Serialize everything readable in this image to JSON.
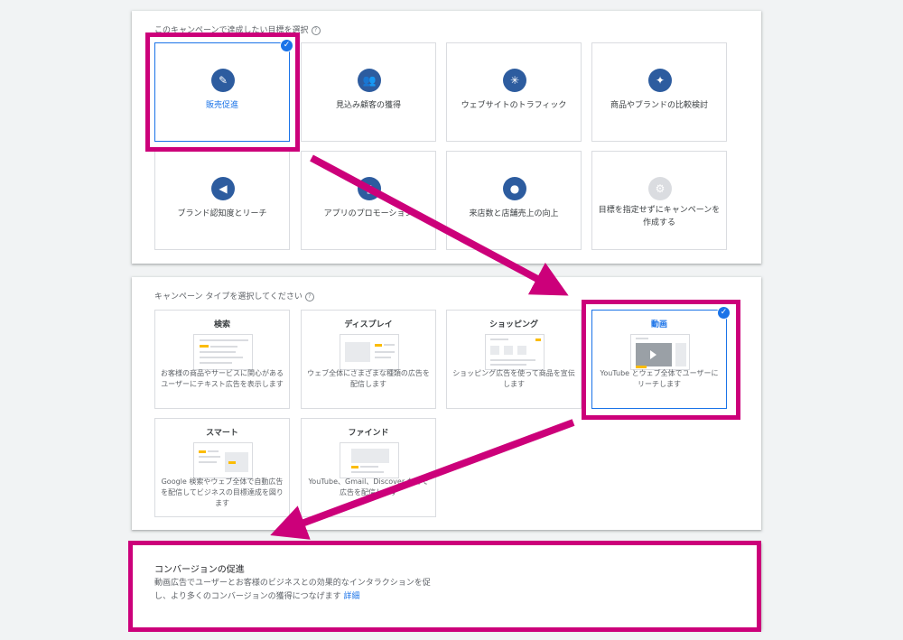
{
  "goal_section": {
    "label": "このキャンペーンで達成したい目標を選択",
    "help_icon": "?",
    "goals": [
      {
        "label": "販売促進",
        "icon": "tag-icon",
        "glyph": "✎",
        "selected": true
      },
      {
        "label": "見込み顧客の獲得",
        "icon": "people-icon",
        "glyph": "👥",
        "selected": false
      },
      {
        "label": "ウェブサイトのトラフィック",
        "icon": "cursor-click-icon",
        "glyph": "✳",
        "selected": false
      },
      {
        "label": "商品やブランドの比較検討",
        "icon": "sparkle-icon",
        "glyph": "✦",
        "selected": false
      },
      {
        "label": "ブランド認知度とリーチ",
        "icon": "speaker-icon",
        "glyph": "◀",
        "selected": false
      },
      {
        "label": "アプリのプロモーション",
        "icon": "phone-icon",
        "glyph": "▯",
        "selected": false
      },
      {
        "label": "来店数と店舗売上の向上",
        "icon": "location-pin-icon",
        "glyph": "●",
        "selected": false
      },
      {
        "label": "目標を指定せずにキャンペーンを作成する",
        "icon": "gear-icon",
        "glyph": "⚙",
        "selected": false
      }
    ]
  },
  "type_section": {
    "label": "キャンペーン タイプを選択してください",
    "help_icon": "?",
    "types": [
      {
        "title": "検索",
        "desc": "お客様の商品やサービスに関心があるユーザーにテキスト広告を表示します",
        "selected": false
      },
      {
        "title": "ディスプレイ",
        "desc": "ウェブ全体にさまざまな種類の広告を配信します",
        "selected": false
      },
      {
        "title": "ショッピング",
        "desc": "ショッピング広告を使って商品を宣伝します",
        "selected": false
      },
      {
        "title": "動画",
        "desc": "YouTube とウェブ全体でユーザーにリーチします",
        "selected": true
      },
      {
        "title": "スマート",
        "desc": "Google 検索やウェブ全体で自動広告を配信してビジネスの目標達成を図ります",
        "selected": false
      },
      {
        "title": "ファインド",
        "desc": "YouTube、Gmail、Discover などで広告を配信します",
        "selected": false
      }
    ]
  },
  "check_glyph": "✓",
  "conversion": {
    "title": "コンバージョンの促進",
    "desc": "動画広告でユーザーとお客様のビジネスとの効果的なインタラクションを促し、より多くのコンバージョンの獲得につなげます",
    "link": "詳細"
  },
  "colors": {
    "highlight": "#cc007a",
    "accent": "#1a73e8",
    "icon_bg": "#2d5c9f"
  }
}
